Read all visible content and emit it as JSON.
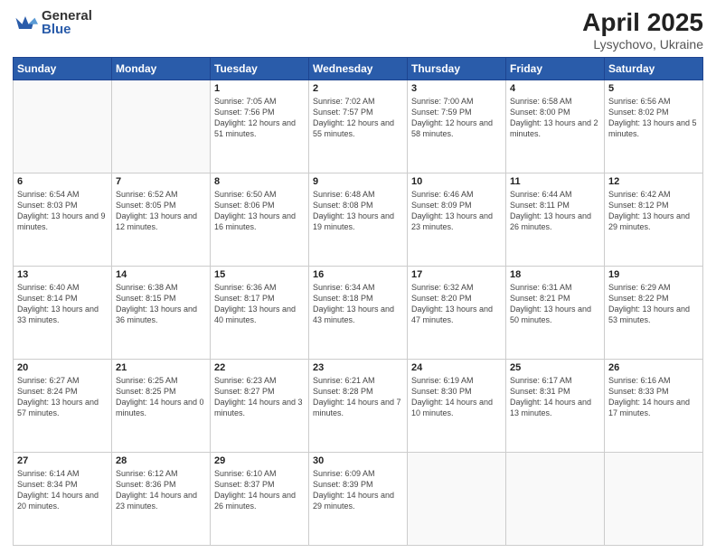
{
  "logo": {
    "general": "General",
    "blue": "Blue"
  },
  "title": "April 2025",
  "subtitle": "Lysychovo, Ukraine",
  "days_of_week": [
    "Sunday",
    "Monday",
    "Tuesday",
    "Wednesday",
    "Thursday",
    "Friday",
    "Saturday"
  ],
  "weeks": [
    [
      {
        "day": "",
        "info": ""
      },
      {
        "day": "",
        "info": ""
      },
      {
        "day": "1",
        "info": "Sunrise: 7:05 AM\nSunset: 7:56 PM\nDaylight: 12 hours and 51 minutes."
      },
      {
        "day": "2",
        "info": "Sunrise: 7:02 AM\nSunset: 7:57 PM\nDaylight: 12 hours and 55 minutes."
      },
      {
        "day": "3",
        "info": "Sunrise: 7:00 AM\nSunset: 7:59 PM\nDaylight: 12 hours and 58 minutes."
      },
      {
        "day": "4",
        "info": "Sunrise: 6:58 AM\nSunset: 8:00 PM\nDaylight: 13 hours and 2 minutes."
      },
      {
        "day": "5",
        "info": "Sunrise: 6:56 AM\nSunset: 8:02 PM\nDaylight: 13 hours and 5 minutes."
      }
    ],
    [
      {
        "day": "6",
        "info": "Sunrise: 6:54 AM\nSunset: 8:03 PM\nDaylight: 13 hours and 9 minutes."
      },
      {
        "day": "7",
        "info": "Sunrise: 6:52 AM\nSunset: 8:05 PM\nDaylight: 13 hours and 12 minutes."
      },
      {
        "day": "8",
        "info": "Sunrise: 6:50 AM\nSunset: 8:06 PM\nDaylight: 13 hours and 16 minutes."
      },
      {
        "day": "9",
        "info": "Sunrise: 6:48 AM\nSunset: 8:08 PM\nDaylight: 13 hours and 19 minutes."
      },
      {
        "day": "10",
        "info": "Sunrise: 6:46 AM\nSunset: 8:09 PM\nDaylight: 13 hours and 23 minutes."
      },
      {
        "day": "11",
        "info": "Sunrise: 6:44 AM\nSunset: 8:11 PM\nDaylight: 13 hours and 26 minutes."
      },
      {
        "day": "12",
        "info": "Sunrise: 6:42 AM\nSunset: 8:12 PM\nDaylight: 13 hours and 29 minutes."
      }
    ],
    [
      {
        "day": "13",
        "info": "Sunrise: 6:40 AM\nSunset: 8:14 PM\nDaylight: 13 hours and 33 minutes."
      },
      {
        "day": "14",
        "info": "Sunrise: 6:38 AM\nSunset: 8:15 PM\nDaylight: 13 hours and 36 minutes."
      },
      {
        "day": "15",
        "info": "Sunrise: 6:36 AM\nSunset: 8:17 PM\nDaylight: 13 hours and 40 minutes."
      },
      {
        "day": "16",
        "info": "Sunrise: 6:34 AM\nSunset: 8:18 PM\nDaylight: 13 hours and 43 minutes."
      },
      {
        "day": "17",
        "info": "Sunrise: 6:32 AM\nSunset: 8:20 PM\nDaylight: 13 hours and 47 minutes."
      },
      {
        "day": "18",
        "info": "Sunrise: 6:31 AM\nSunset: 8:21 PM\nDaylight: 13 hours and 50 minutes."
      },
      {
        "day": "19",
        "info": "Sunrise: 6:29 AM\nSunset: 8:22 PM\nDaylight: 13 hours and 53 minutes."
      }
    ],
    [
      {
        "day": "20",
        "info": "Sunrise: 6:27 AM\nSunset: 8:24 PM\nDaylight: 13 hours and 57 minutes."
      },
      {
        "day": "21",
        "info": "Sunrise: 6:25 AM\nSunset: 8:25 PM\nDaylight: 14 hours and 0 minutes."
      },
      {
        "day": "22",
        "info": "Sunrise: 6:23 AM\nSunset: 8:27 PM\nDaylight: 14 hours and 3 minutes."
      },
      {
        "day": "23",
        "info": "Sunrise: 6:21 AM\nSunset: 8:28 PM\nDaylight: 14 hours and 7 minutes."
      },
      {
        "day": "24",
        "info": "Sunrise: 6:19 AM\nSunset: 8:30 PM\nDaylight: 14 hours and 10 minutes."
      },
      {
        "day": "25",
        "info": "Sunrise: 6:17 AM\nSunset: 8:31 PM\nDaylight: 14 hours and 13 minutes."
      },
      {
        "day": "26",
        "info": "Sunrise: 6:16 AM\nSunset: 8:33 PM\nDaylight: 14 hours and 17 minutes."
      }
    ],
    [
      {
        "day": "27",
        "info": "Sunrise: 6:14 AM\nSunset: 8:34 PM\nDaylight: 14 hours and 20 minutes."
      },
      {
        "day": "28",
        "info": "Sunrise: 6:12 AM\nSunset: 8:36 PM\nDaylight: 14 hours and 23 minutes."
      },
      {
        "day": "29",
        "info": "Sunrise: 6:10 AM\nSunset: 8:37 PM\nDaylight: 14 hours and 26 minutes."
      },
      {
        "day": "30",
        "info": "Sunrise: 6:09 AM\nSunset: 8:39 PM\nDaylight: 14 hours and 29 minutes."
      },
      {
        "day": "",
        "info": ""
      },
      {
        "day": "",
        "info": ""
      },
      {
        "day": "",
        "info": ""
      }
    ]
  ]
}
